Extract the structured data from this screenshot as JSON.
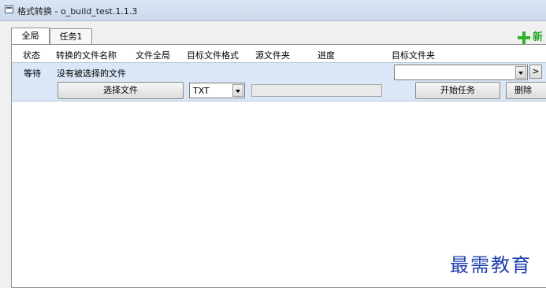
{
  "window": {
    "title": "格式转换 - o_build_test.1.1.3"
  },
  "tabs": [
    {
      "label": "全局"
    },
    {
      "label": "任务1"
    }
  ],
  "toolbar": {
    "new_label": "新"
  },
  "columns": [
    "状态",
    "转换的文件名称",
    "文件全局",
    "目标文件格式",
    "源文件夹",
    "进度",
    "目标文件夹"
  ],
  "task": {
    "status": "等待",
    "file_name": "没有被选择的文件",
    "select_file_label": "选择文件",
    "format_value": "TXT",
    "target_folder_value": "",
    "browse_label": ">",
    "start_label": "开始任务",
    "delete_label": "删除",
    "progress": 0
  },
  "watermark": "最需教育"
}
